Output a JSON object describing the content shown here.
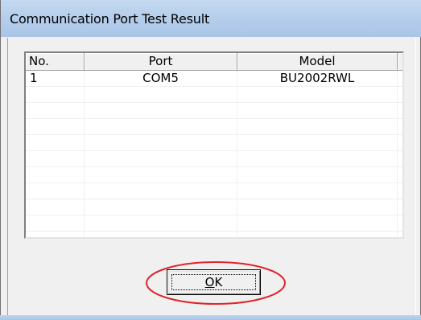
{
  "window": {
    "title": "Communication Port Test Result"
  },
  "table": {
    "columns": [
      "No.",
      "Port",
      "Model"
    ],
    "rows": [
      {
        "no": "1",
        "port": "COM5",
        "model": "BU2002RWL"
      }
    ],
    "empty_row_count": 10
  },
  "ok_button": {
    "label_accel": "O",
    "label_rest": "K",
    "full_label": "OK"
  },
  "annotation": {
    "highlight_color": "#e0242c"
  }
}
